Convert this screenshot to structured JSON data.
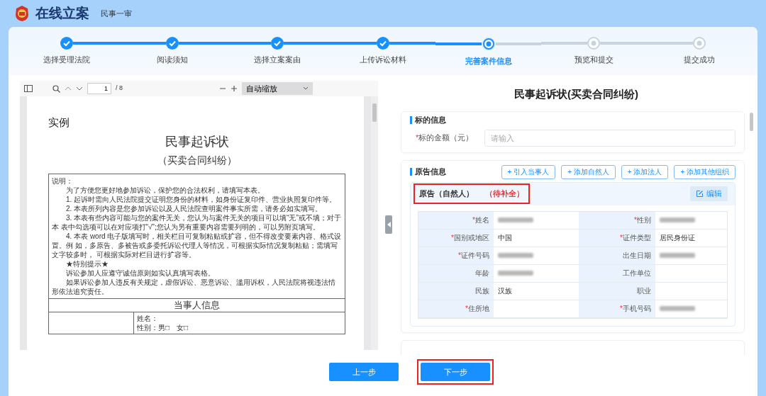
{
  "header": {
    "title": "在线立案",
    "subtitle": "民事一审"
  },
  "steps": [
    {
      "label": "选择受理法院",
      "completed": true,
      "selected": false
    },
    {
      "label": "阅读须知",
      "completed": true,
      "selected": false
    },
    {
      "label": "选择立案案由",
      "completed": true,
      "selected": false
    },
    {
      "label": "上传诉讼材料",
      "completed": true,
      "selected": false
    },
    {
      "label": "完善案件信息",
      "completed": false,
      "selected": true
    },
    {
      "label": "预览和提交",
      "completed": false,
      "selected": false
    },
    {
      "label": "提交成功",
      "completed": false,
      "selected": false
    }
  ],
  "pdf_viewer": {
    "page": "1",
    "page_count": "/ 8",
    "zoom": "自动缩放",
    "document": {
      "heading": "实例",
      "title": "民事起诉状",
      "subtitle": "（买卖合同纠纷）",
      "notice_title": "说明：",
      "notice": [
        "为了方便您更好地参加诉讼，保护您的合法权利，请填写本表。",
        "1. 起诉时需向人民法院提交证明您身份的材料，如身份证复印件、营业执照复印件等。",
        "2. 本表所列内容是您参加诉讼以及人民法院查明案件事实所需，请务必如实填写。",
        "3. 本表有些内容可能与您的案件无关，您认为与案件无关的项目可以填“无”或不填；对于本 表中勾选项可以在对应项打“√”;您认为另有重要内容需要列明的，可以另附页填写。",
        "4. 本表 word 电子版填写时，相关栏目可复制粘贴或扩容，但不得改变要素内容、格式设置。例 如，多原告、多被告或多委托诉讼代理人等情况，可根据实际情况复制粘贴；需填写文字较多时， 可根据实际对栏目进行扩容等。",
        "★特别提示★",
        "诉讼参加人应遵守诚信原则如实认真填写表格。",
        "如果诉讼参加人违反有关规定，虚假诉讼、恶意诉讼、滥用诉权，人民法院将视违法情形依法追究责任。"
      ],
      "section": "当事人信息",
      "lines": [
        "姓名：",
        "性别：男□　女□"
      ]
    }
  },
  "form": {
    "title": "民事起诉状(买卖合同纠纷)",
    "subject": {
      "title": "标的信息",
      "label": "标的金额（元）",
      "mark": "*",
      "placeholder": "请输入"
    },
    "plaintiff": {
      "title": "原告信息",
      "buttons": [
        "+ 引入当事人",
        "+ 添加自然人",
        "+ 添加法人",
        "+ 添加其他组织"
      ],
      "party": {
        "title": "原告（自然人）",
        "status": "（待补全）",
        "highlighted": true,
        "edit": "编辑",
        "fields": [
          {
            "label": "姓名",
            "mark": "*",
            "redacted": true
          },
          {
            "label": "性别",
            "mark": "*",
            "redacted": true
          },
          {
            "label": "国别或地区",
            "mark": "*",
            "value": "中国"
          },
          {
            "label": "证件类型",
            "mark": "*",
            "value": "居民身份证"
          },
          {
            "label": "证件号码",
            "mark": "*",
            "redacted": true
          },
          {
            "label": "出生日期",
            "redacted": true
          },
          {
            "label": "年龄",
            "redacted": true
          },
          {
            "label": "工作单位"
          },
          {
            "label": "民族",
            "value": "汉族"
          },
          {
            "label": "职业"
          },
          {
            "label": "住所地",
            "mark": "*"
          },
          {
            "label": "手机号码",
            "mark": "*",
            "redacted": true
          }
        ]
      }
    }
  },
  "buttons": [
    {
      "label": "上一步",
      "highlighted": false
    },
    {
      "label": "下一步",
      "highlighted": true
    }
  ]
}
